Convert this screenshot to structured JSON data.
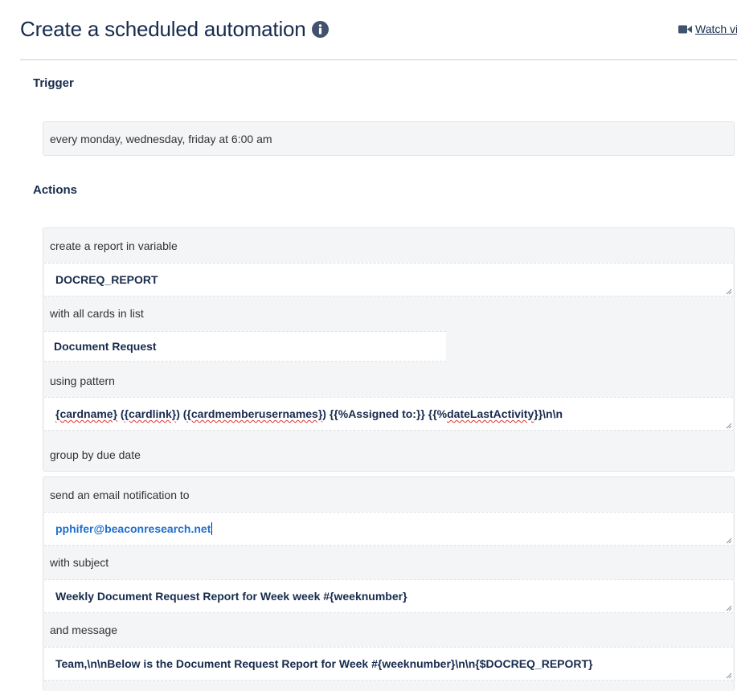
{
  "header": {
    "title": "Create a scheduled automation",
    "watch_label": "Watch vi"
  },
  "trigger": {
    "heading": "Trigger",
    "value": "every monday, wednesday, friday at 6:00 am"
  },
  "actions": {
    "heading": "Actions",
    "report": {
      "label_create": "create a report in variable",
      "variable": "DOCREQ_REPORT",
      "label_cards": "with all cards in list",
      "list_name": "Document Request",
      "label_pattern": "using pattern",
      "pattern": {
        "cardname": "{cardname}",
        "p_open": " (",
        "cardlink": "{cardlink}",
        "p_mid": ") (",
        "members": "{cardmemberusernames}",
        "p_assigned": ") {{%Assigned to:}} {{%",
        "last_activity": "dateLastActivity",
        "tail": "}}\\n\\n"
      },
      "label_group": "group by due date"
    },
    "email": {
      "label_send": "send an email notification to",
      "to": "pphifer@beaconresearch.net",
      "label_subject": "with subject",
      "subject": "Weekly Document Request Report for Week week #{weeknumber}",
      "label_message": "and message",
      "message": "Team,\\n\\nBelow is the Document Request Report for Week #{weeknumber}\\n\\n{$DOCREQ_REPORT}"
    }
  },
  "icons": {
    "info": "info-circle-icon",
    "video": "video-camera-icon",
    "resize": "resize-grip-icon"
  }
}
